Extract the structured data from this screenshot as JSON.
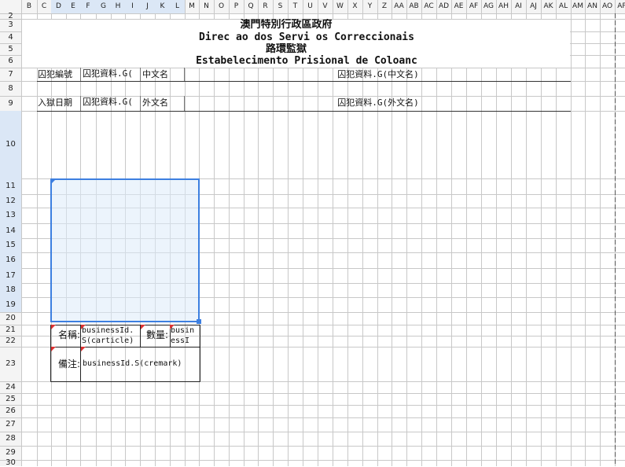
{
  "column_headers": [
    "B",
    "C",
    "D",
    "E",
    "F",
    "G",
    "H",
    "I",
    "J",
    "K",
    "L",
    "M",
    "N",
    "O",
    "P",
    "Q",
    "R",
    "S",
    "T",
    "U",
    "V",
    "W",
    "X",
    "Y",
    "Z",
    "AA",
    "AB",
    "AC",
    "AD",
    "AE",
    "AF",
    "AG",
    "AH",
    "AI",
    "AJ",
    "AK",
    "AL",
    "AM",
    "AN",
    "AO",
    "AP"
  ],
  "selected_columns": [
    "D",
    "E",
    "F",
    "G",
    "H",
    "I",
    "J",
    "K",
    "L"
  ],
  "row_headers": [
    "2",
    "3",
    "4",
    "5",
    "6",
    "7",
    "8",
    "9",
    "10",
    "11",
    "12",
    "13",
    "14",
    "15",
    "16",
    "17",
    "18",
    "19",
    "20",
    "21",
    "22",
    "23",
    "24",
    "25",
    "26",
    "27",
    "28",
    "29",
    "30"
  ],
  "selected_rows": [
    "10",
    "11",
    "12",
    "13",
    "14",
    "15",
    "16",
    "17",
    "18",
    "19"
  ],
  "header": {
    "line1": "澳門特別行政區政府",
    "line2": "Direc ao dos Servi os Correccionais",
    "line3": "路環監獄",
    "line4": "Estabelecimento Prisional de Coloanc"
  },
  "form": {
    "inmate_no_label": "囚犯編號",
    "inmate_no_value": "囚犯資料.G(",
    "chinese_name_label": "中文名",
    "chinese_name_value": "囚犯資料.G(中文名)",
    "admission_date_label": "入獄日期",
    "admission_date_value": "囚犯資料.G(",
    "foreign_name_label": "外文名",
    "foreign_name_value": "囚犯資料.G(外文名)"
  },
  "item_table": {
    "name_label": "名稱:",
    "name_value_1": "businessId.",
    "name_value_2": "S(carticle)",
    "qty_label": "數量:",
    "qty_value_1": "busin",
    "qty_value_2": "essI",
    "remark_label": "備注:",
    "remark_value": "businessId.S(cremark)"
  },
  "colors": {
    "selection_border": "#3d7fe0",
    "selection_fill": "#dcebfa",
    "header_highlight": "#dbe7f6",
    "grid_line": "#c8c8c8",
    "comment_marker": "#dd3333"
  }
}
